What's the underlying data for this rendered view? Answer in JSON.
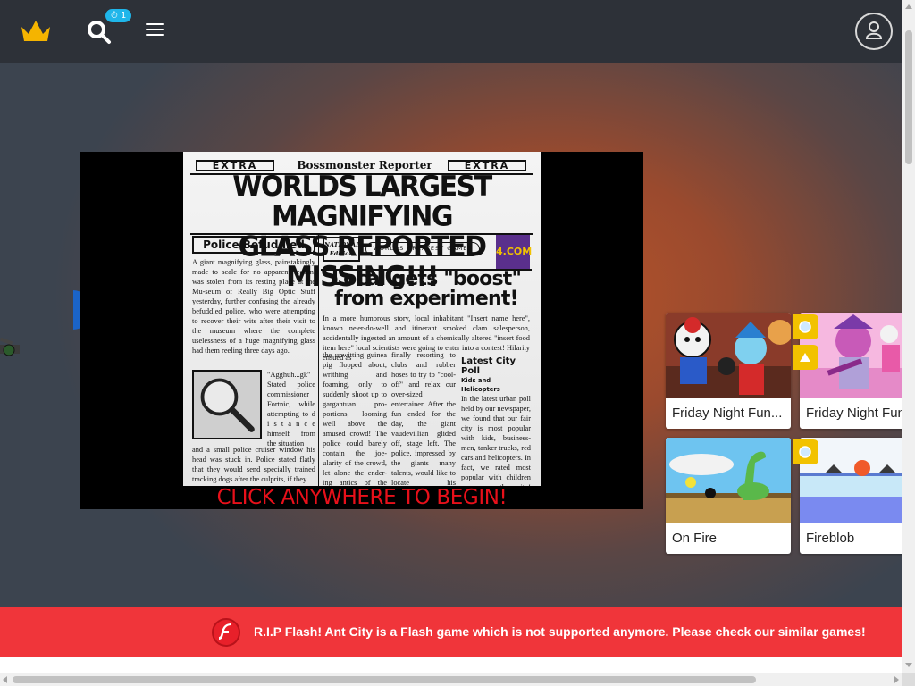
{
  "header": {
    "logo_icon": "crown-icon",
    "search_icon": "search-icon",
    "notification_count": "1",
    "menu_icon": "hamburger-menu-icon",
    "user_icon": "user-account-icon"
  },
  "game": {
    "newspaper": {
      "extra_left": "EXTRA",
      "masthead": "Bossmonster Reporter",
      "extra_right": "EXTRA",
      "headline_line1": "WORLDS LARGEST MAGNIFYING",
      "headline_line2": "GLASS REPORTED MISSING!!!",
      "subhead_left": "Police Befuddled",
      "story_left": "A giant magnifying glass, painstakingly made to scale for no apparent reason, was stolen from its resting place at the Mu-seum of Really Big Optic Stuff yesterday, further confusing the already befuddled police, who were attempting to recover their wits after their visit to the museum where the complete uselessness of a huge magnifying glass had them reeling three days ago.",
      "mag_caption": "\"Agghuh...gk\" Stated police commissioner Fortnic, while attempting to d i s t a n c e himself from the situation",
      "story_below_mag": "and a small police cruiser window his head was stuck in. Police stated flatly that they would send specially trained tracking dogs after the culprits, if they",
      "badge_national": "NATIONAL Edition",
      "badge_worlds": "WORLDS GREATEST GAMES",
      "badge_4com": "4.COM",
      "headline2": "Local gets \"boost\" from experiment!",
      "story_mid": "In a more humorous story, local inhabitant \"Insert name here\", known ne'er-do-well and itinerant smoked clam salesperson, accidentally ingested an amount of a chemically altered \"insert food item here\" local scientists were going to enter into a contest! Hilarity ensued as",
      "col_a": "the unwitting guinea pig flopped about, writhing and foaming, only to suddenly shoot up to gargantuan pro-portions, looming well above the amused crowd! The police could barely contain the joe-ularity of the crowd, let alone the ender-ing antics of the newly up-scaled \"insert name here\".",
      "col_b": "finally resorting to clubs and rubber hoses to try to \"cool-off\" and relax our over-sized entertainer. After the fun ended for the day, the giant vaudevillian glided off, stage left. The police, impressed by the giants many talents, would like to locate his whereabouts for questions about future engagements.",
      "poll_title": "Latest City Poll",
      "poll_sub": "Kids and Helicopters",
      "poll_body": "In the latest urban poll held by our newspaper, we found that our fair city is most popular with kids, business-men, tanker trucks, red cars and helicopters. In fact, we rated most popular with children over any other city! We have no idea what to"
    },
    "cta": "CLICK ANYWHERE TO BEGIN!"
  },
  "similar_games": [
    {
      "title": "Friday Night Fun...",
      "badge": "yellow"
    },
    {
      "title": "Friday Night Fun",
      "badge": "yellow"
    },
    {
      "title": "On Fire",
      "badge": "none"
    },
    {
      "title": "Fireblob",
      "badge": "yellow"
    }
  ],
  "flash_banner": {
    "icon": "adobe-flash-icon",
    "text": "R.I.P Flash! Ant City is a Flash game which is not supported anymore. Please check our similar games!"
  },
  "colors": {
    "topbar": "#2d3138",
    "banner": "#f0353a",
    "accent_blue": "#1fb6ea",
    "crown": "#f5b400",
    "cta_red": "#e8101a"
  }
}
